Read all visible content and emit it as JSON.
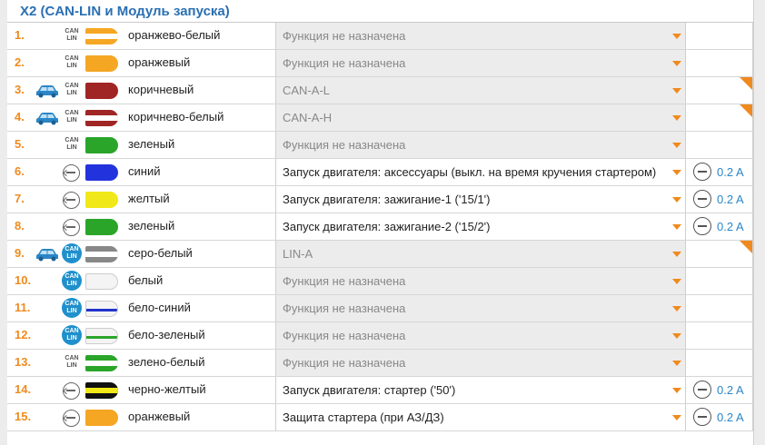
{
  "header": {
    "title": "X2 (CAN-LIN и Модуль запуска)"
  },
  "badge": {
    "can": "CAN",
    "lin": "LIN"
  },
  "rows": [
    {
      "num": "1.",
      "car": false,
      "badge": "plain",
      "toggle": false,
      "wire": "#f5a623",
      "stripe": "#ffffff",
      "color_name": "оранжево-белый",
      "function": "Функция не назначена",
      "enabled": false,
      "current": "",
      "corner": false
    },
    {
      "num": "2.",
      "car": false,
      "badge": "plain",
      "toggle": false,
      "wire": "#f5a623",
      "stripe": "",
      "color_name": "оранжевый",
      "function": "Функция не назначена",
      "enabled": false,
      "current": "",
      "corner": false
    },
    {
      "num": "3.",
      "car": true,
      "badge": "plain",
      "toggle": false,
      "wire": "#a02525",
      "stripe": "",
      "color_name": "коричневый",
      "function": "CAN-A-L",
      "enabled": false,
      "current": "",
      "corner": true
    },
    {
      "num": "4.",
      "car": true,
      "badge": "plain",
      "toggle": false,
      "wire": "#a02525",
      "stripe": "#ffffff",
      "color_name": "коричнево-белый",
      "function": "CAN-A-H",
      "enabled": false,
      "current": "",
      "corner": true
    },
    {
      "num": "5.",
      "car": false,
      "badge": "plain",
      "toggle": false,
      "wire": "#2aa52a",
      "stripe": "",
      "color_name": "зеленый",
      "function": "Функция не назначена",
      "enabled": false,
      "current": "",
      "corner": false
    },
    {
      "num": "6.",
      "car": false,
      "badge": "none",
      "toggle": true,
      "wire": "#2233dd",
      "stripe": "",
      "color_name": "синий",
      "function": "Запуск двигателя: аксессуары (выкл. на время кручения стартером)",
      "enabled": true,
      "current": "0.2 A",
      "corner": false
    },
    {
      "num": "7.",
      "car": false,
      "badge": "none",
      "toggle": true,
      "wire": "#f0e818",
      "stripe": "",
      "color_name": "желтый",
      "function": "Запуск двигателя: зажигание-1 ('15/1')",
      "enabled": true,
      "current": "0.2 A",
      "corner": false
    },
    {
      "num": "8.",
      "car": false,
      "badge": "none",
      "toggle": true,
      "wire": "#2aa52a",
      "stripe": "",
      "color_name": "зеленый",
      "function": "Запуск двигателя: зажигание-2 ('15/2')",
      "enabled": true,
      "current": "0.2 A",
      "corner": false
    },
    {
      "num": "9.",
      "car": true,
      "badge": "active",
      "toggle": false,
      "wire": "#888888",
      "stripe": "#ffffff",
      "color_name": "серо-белый",
      "function": "LIN-A",
      "enabled": false,
      "current": "",
      "corner": true
    },
    {
      "num": "10.",
      "car": false,
      "badge": "active",
      "toggle": false,
      "wire": "#f4f4f4",
      "stripe": "",
      "color_name": "белый",
      "function": "Функция не назначена",
      "enabled": false,
      "current": "",
      "corner": false
    },
    {
      "num": "11.",
      "car": false,
      "badge": "active",
      "toggle": false,
      "wire": "#f4f4f4",
      "stripe": "#2233cc",
      "color_name": "бело-синий",
      "function": "Функция не назначена",
      "enabled": false,
      "current": "",
      "corner": false
    },
    {
      "num": "12.",
      "car": false,
      "badge": "active",
      "toggle": false,
      "wire": "#f4f4f4",
      "stripe": "#2aa52a",
      "color_name": "бело-зеленый",
      "function": "Функция не назначена",
      "enabled": false,
      "current": "",
      "corner": false
    },
    {
      "num": "13.",
      "car": false,
      "badge": "plain",
      "toggle": false,
      "wire": "#2aa52a",
      "stripe": "#ffffff",
      "color_name": "зелено-белый",
      "function": "Функция не назначена",
      "enabled": false,
      "current": "",
      "corner": false
    },
    {
      "num": "14.",
      "car": false,
      "badge": "none",
      "toggle": true,
      "wire": "#111111",
      "stripe": "#f0e818",
      "color_name": "черно-желтый",
      "function": "Запуск двигателя: стартер ('50')",
      "enabled": true,
      "current": "0.2 A",
      "corner": false
    },
    {
      "num": "15.",
      "car": false,
      "badge": "none",
      "toggle": true,
      "wire": "#f5a623",
      "stripe": "",
      "color_name": "оранжевый",
      "function": "Защита стартера (при АЗ/ДЗ)",
      "enabled": true,
      "current": "0.2 A",
      "corner": false
    }
  ]
}
